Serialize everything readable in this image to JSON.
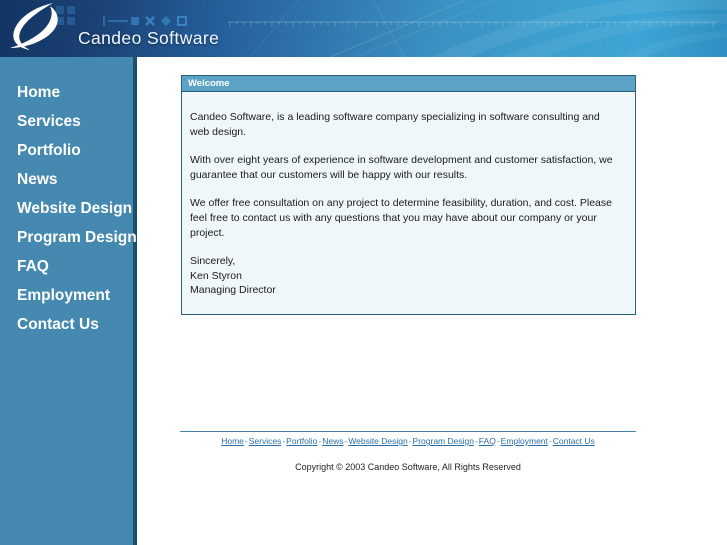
{
  "header": {
    "logo_icon": "candeo-swoosh-logo",
    "brand_title": "Candeo Software",
    "gradient_left": "#0c2f5e",
    "gradient_right": "#2f9ed2"
  },
  "sidebar": {
    "background_color": "#4589b0",
    "border_color": "#1d4f6e",
    "items": [
      {
        "label": "Home"
      },
      {
        "label": "Services"
      },
      {
        "label": "Portfolio"
      },
      {
        "label": "News"
      },
      {
        "label": "Website Design"
      },
      {
        "label": "Program Design"
      },
      {
        "label": "FAQ"
      },
      {
        "label": "Employment"
      },
      {
        "label": "Contact Us"
      }
    ]
  },
  "main": {
    "panel": {
      "title": "Welcome",
      "title_bar_color": "#5ba3c6",
      "border_color": "#2a6179",
      "background_color": "#f0f7fb",
      "paragraphs": [
        "Candeo Software, is a leading software company specializing in software consulting and web design.",
        "With over eight years of experience in software development and customer satisfaction, we guarantee that our customers will be happy with our results.",
        "We offer free consultation on any project to determine feasibility, duration, and cost. Please feel free to contact us with any questions that you may have about our company or your project."
      ],
      "signature": [
        "Sincerely,",
        "Ken Styron",
        "Managing Director"
      ]
    }
  },
  "footer": {
    "separator": "-",
    "link_color": "#2b6fa8",
    "links": [
      {
        "label": "Home"
      },
      {
        "label": "Services"
      },
      {
        "label": "Portfolio"
      },
      {
        "label": "News"
      },
      {
        "label": "Website Design"
      },
      {
        "label": "Program Design"
      },
      {
        "label": "FAQ"
      },
      {
        "label": "Employment"
      },
      {
        "label": "Contact Us"
      }
    ],
    "copyright": "Copyright © 2003 Candeo Software, All Rights Reserved"
  }
}
